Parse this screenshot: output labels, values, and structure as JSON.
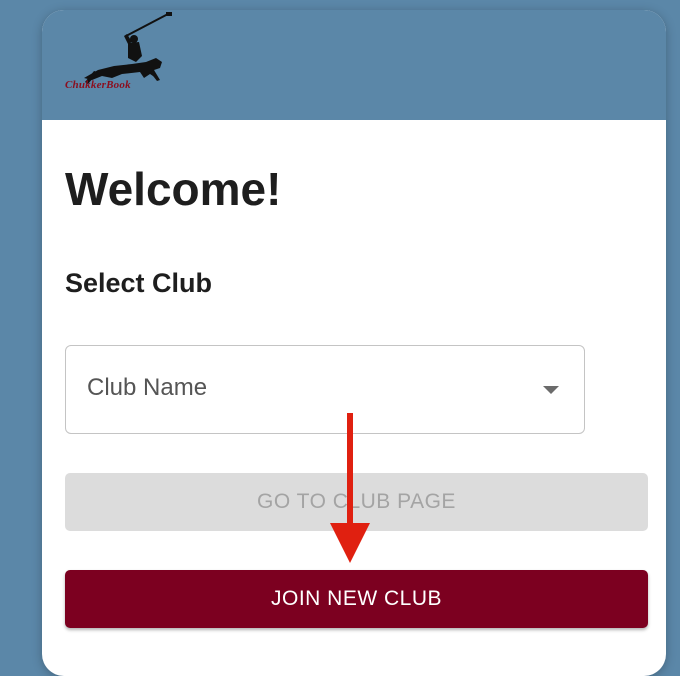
{
  "header": {
    "logo_text": "ChukkerBook"
  },
  "main": {
    "title": "Welcome!",
    "select_label": "Select Club",
    "club_select": {
      "placeholder": "Club Name"
    },
    "go_button_label": "GO TO CLUB PAGE",
    "join_button_label": "JOIN NEW CLUB"
  },
  "annotation": {
    "arrow_color": "#e02010",
    "icon": "arrow-down-icon"
  },
  "colors": {
    "background": "#5b87a8",
    "primary": "#7c0020",
    "disabled": "#dcdcdc"
  }
}
